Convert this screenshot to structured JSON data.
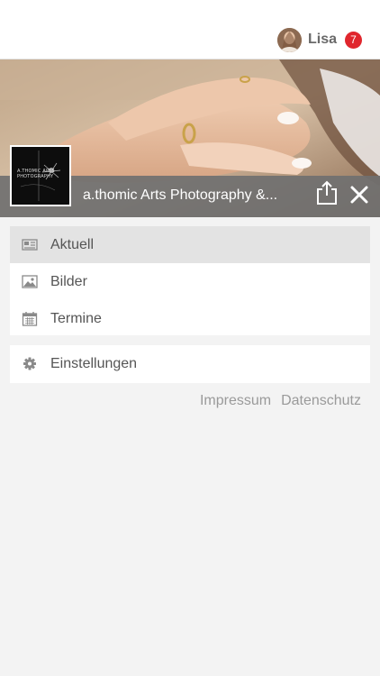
{
  "user": {
    "name": "Lisa",
    "notification_count": "7"
  },
  "page": {
    "title": "a.thomic Arts Photography &...",
    "logo_text": "A.THOMIC ARTS PHOTOGRAPHY"
  },
  "menu": {
    "main_items": [
      {
        "label": "Aktuell",
        "icon": "newspaper-icon",
        "active": true
      },
      {
        "label": "Bilder",
        "icon": "image-icon",
        "active": false
      },
      {
        "label": "Termine",
        "icon": "calendar-icon",
        "active": false
      }
    ],
    "settings_item": {
      "label": "Einstellungen",
      "icon": "gear-icon"
    }
  },
  "footer_links": {
    "imprint": "Impressum",
    "privacy": "Datenschutz"
  },
  "colors": {
    "badge": "#e0262d",
    "title_bar": "#707070",
    "active_item": "#e3e3e3",
    "background": "#f3f3f3"
  }
}
